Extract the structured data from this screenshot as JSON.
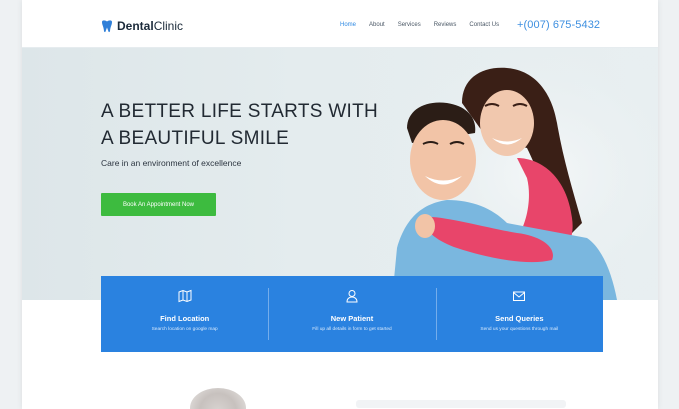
{
  "header": {
    "brand": {
      "part1": "Dental",
      "part2": "Clinic",
      "icon": "tooth-icon"
    },
    "nav": [
      {
        "label": "Home",
        "active": true
      },
      {
        "label": "About"
      },
      {
        "label": "Services"
      },
      {
        "label": "Reviews"
      },
      {
        "label": "Contact Us"
      }
    ],
    "phone": "+(007) 675-5432"
  },
  "hero": {
    "title_line1": "A BETTER LIFE STARTS WITH",
    "title_line2": "A BEAUTIFUL SMILE",
    "subtitle": "Care in an environment of excellence",
    "cta_label": "Book An Appointment Now"
  },
  "features": [
    {
      "icon": "map-icon",
      "title": "Find Location",
      "desc": "Search location on google map"
    },
    {
      "icon": "user-icon",
      "title": "New Patient",
      "desc": "Fill up all details in form to get started"
    },
    {
      "icon": "mail-icon",
      "title": "Send Queries",
      "desc": "Send us your questions through mail"
    }
  ],
  "colors": {
    "accent": "#2a82e0",
    "cta": "#3dbb3f",
    "nav_active": "#2f8ae3",
    "phone": "#3d8fe0"
  }
}
